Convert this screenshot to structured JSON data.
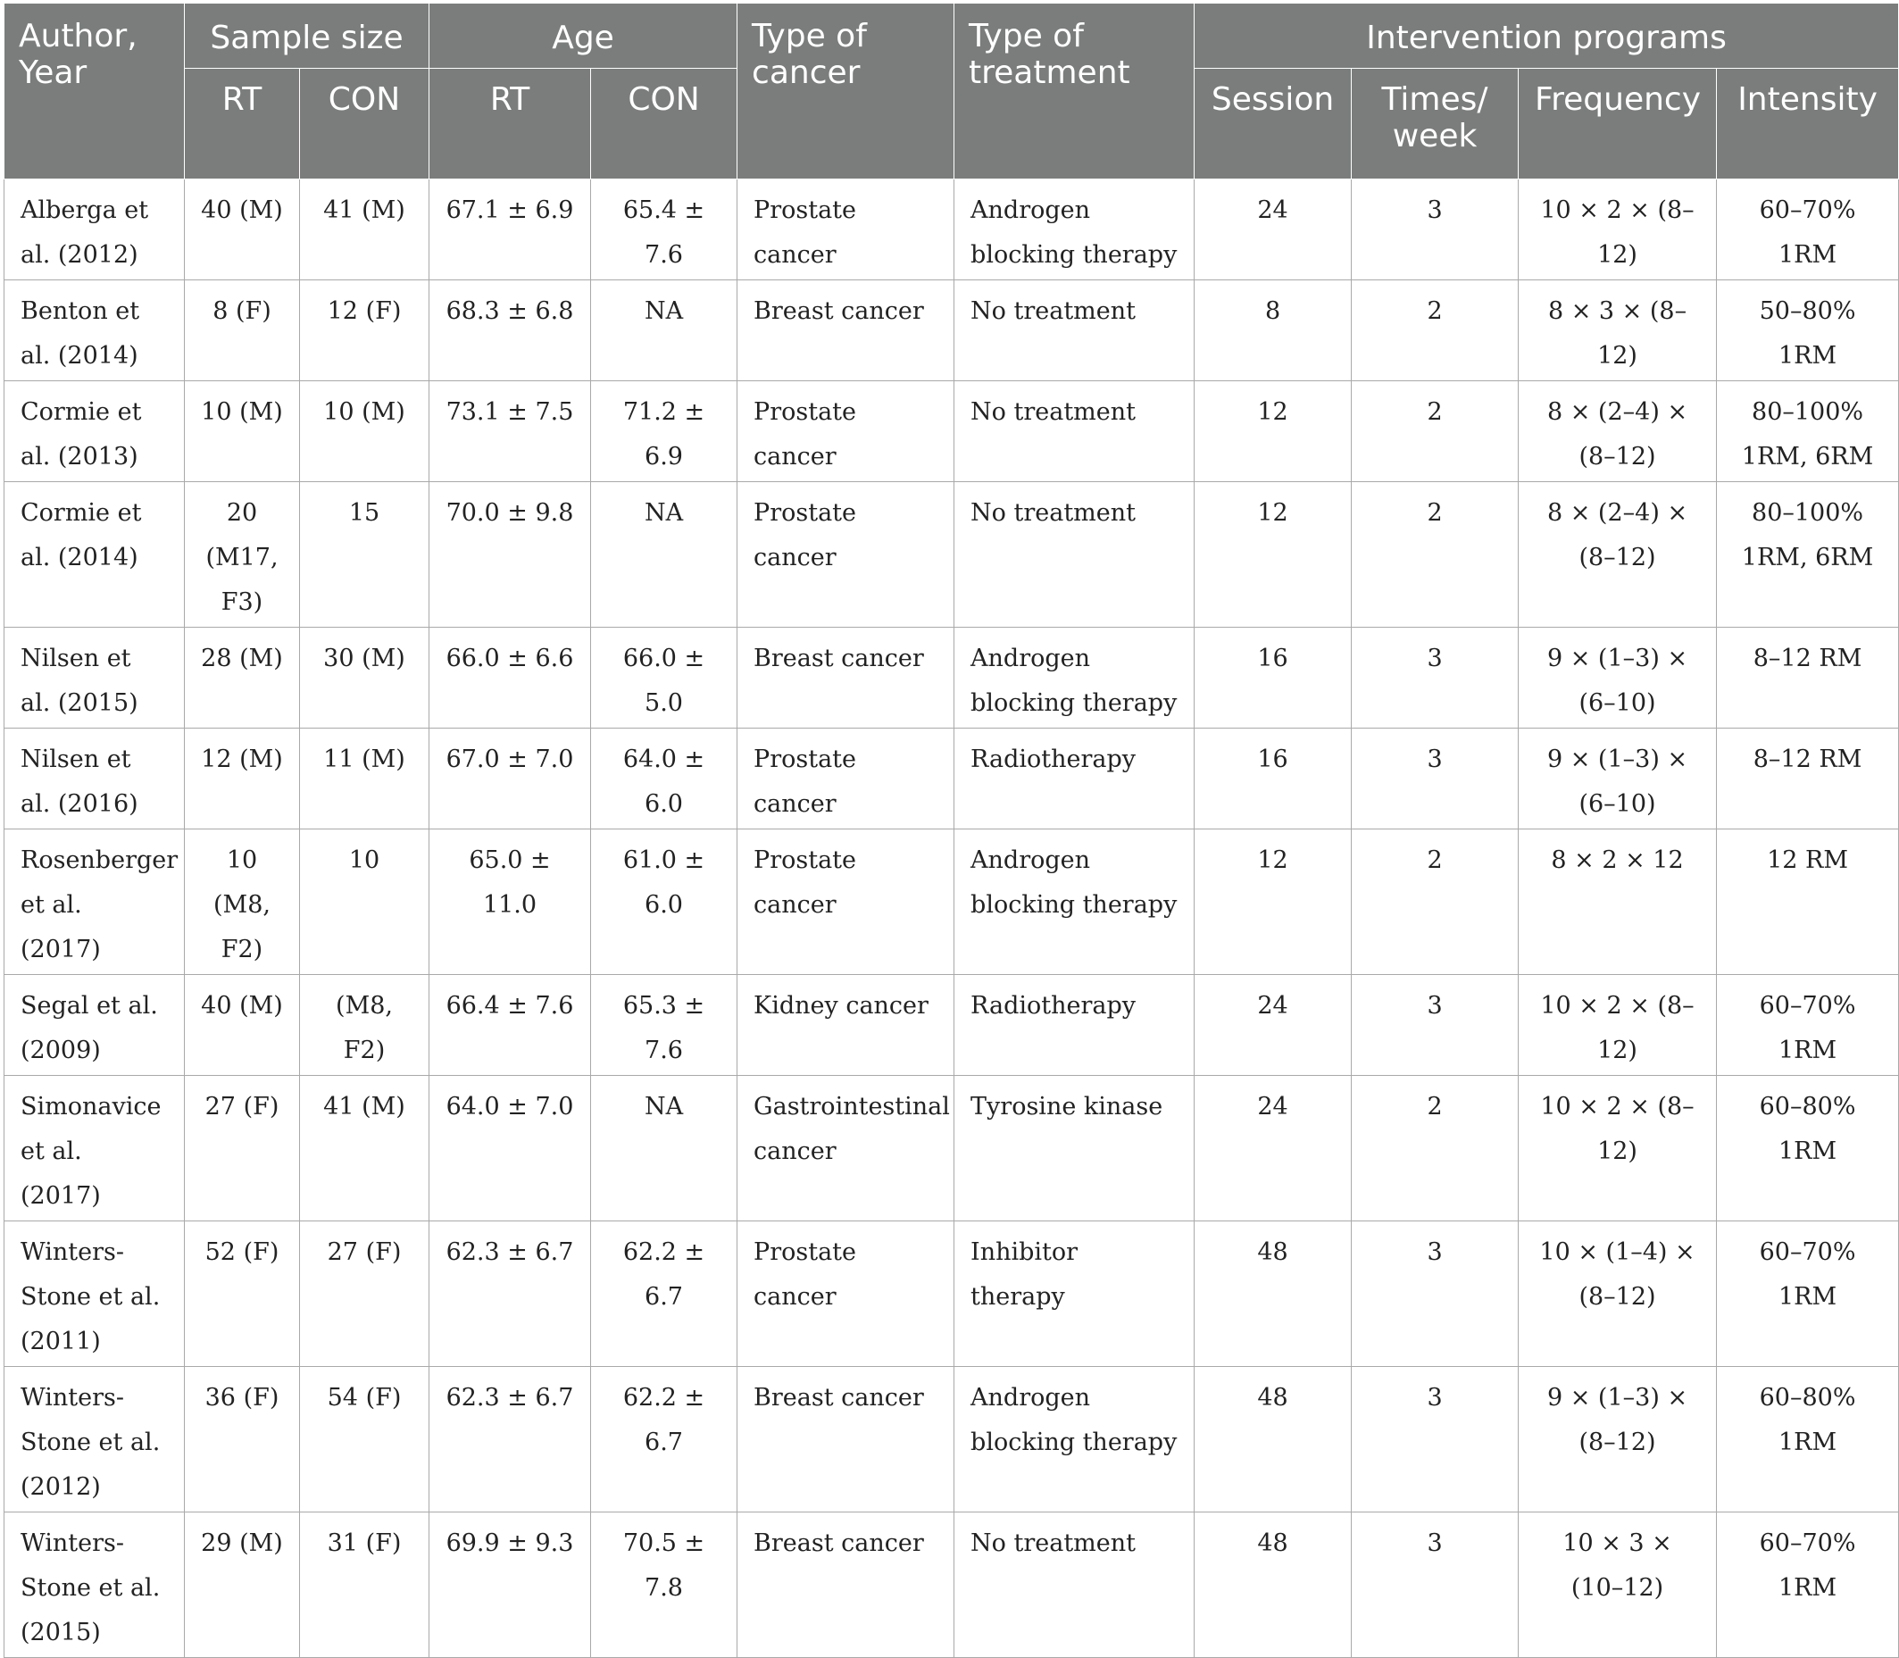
{
  "headers": {
    "author": "Author, Year",
    "sample_size": "Sample size",
    "age": "Age",
    "type_of_cancer": "Type of cancer",
    "type_of_treatment": "Type of treatment",
    "intervention_programs": "Intervention programs",
    "rt": "RT",
    "con": "CON",
    "session": "Session",
    "times_week": "Times/ week",
    "frequency": "Frequency",
    "intensity": "Intensity"
  },
  "rows": [
    {
      "author": "Alberga et al. (2012)",
      "rt_n": "40 (M)",
      "con_n": "41 (M)",
      "rt_age": "67.1 ± 6.9",
      "con_age": "65.4 ± 7.6",
      "cancer": "Prostate cancer",
      "treatment": "Androgen blocking therapy",
      "session": "24",
      "times": "3",
      "frequency": "10 × 2 × (8–12)",
      "intensity": "60–70% 1RM"
    },
    {
      "author": "Benton et al. (2014)",
      "rt_n": "8 (F)",
      "con_n": "12 (F)",
      "rt_age": "68.3 ± 6.8",
      "con_age": "NA",
      "cancer": "Breast cancer",
      "treatment": "No treatment",
      "session": "8",
      "times": "2",
      "frequency": "8 × 3 × (8–12)",
      "intensity": "50–80% 1RM"
    },
    {
      "author": "Cormie et al. (2013)",
      "rt_n": "10 (M)",
      "con_n": "10 (M)",
      "rt_age": "73.1 ± 7.5",
      "con_age": "71.2 ± 6.9",
      "cancer": "Prostate cancer",
      "treatment": "No treatment",
      "session": "12",
      "times": "2",
      "frequency": "8 × (2–4) × (8–12)",
      "intensity": "80–100% 1RM, 6RM"
    },
    {
      "author": "Cormie et al. (2014)",
      "rt_n": "20 (M17, F3)",
      "con_n": "15",
      "rt_age": "70.0 ± 9.8",
      "con_age": "NA",
      "cancer": "Prostate cancer",
      "treatment": "No treatment",
      "session": "12",
      "times": "2",
      "frequency": "8 × (2–4) × (8–12)",
      "intensity": "80–100% 1RM, 6RM"
    },
    {
      "author": "Nilsen et al. (2015)",
      "rt_n": "28 (M)",
      "con_n": "30 (M)",
      "rt_age": "66.0 ± 6.6",
      "con_age": "66.0 ± 5.0",
      "cancer": "Breast cancer",
      "treatment": "Androgen blocking therapy",
      "session": "16",
      "times": "3",
      "frequency": "9 × (1–3) × (6–10)",
      "intensity": "8–12 RM"
    },
    {
      "author": "Nilsen et al. (2016)",
      "rt_n": "12 (M)",
      "con_n": "11 (M)",
      "rt_age": "67.0 ± 7.0",
      "con_age": "64.0 ± 6.0",
      "cancer": "Prostate cancer",
      "treatment": "Radiotherapy",
      "session": "16",
      "times": "3",
      "frequency": "9 × (1–3) × (6–10)",
      "intensity": "8–12 RM"
    },
    {
      "author": "Rosenberger et al. (2017)",
      "rt_n": "10 (M8, F2)",
      "con_n": "10",
      "rt_age": "65.0 ± 11.0",
      "con_age": "61.0 ± 6.0",
      "cancer": "Prostate cancer",
      "treatment": "Androgen blocking therapy",
      "session": "12",
      "times": "2",
      "frequency": "8 × 2 × 12",
      "intensity": "12 RM"
    },
    {
      "author": "Segal et al. (2009)",
      "rt_n": "40 (M)",
      "con_n": "(M8, F2)",
      "rt_age": "66.4 ± 7.6",
      "con_age": "65.3 ± 7.6",
      "cancer": "Kidney cancer",
      "treatment": "Radiotherapy",
      "session": "24",
      "times": "3",
      "frequency": "10 × 2 × (8–12)",
      "intensity": "60–70% 1RM"
    },
    {
      "author": "Simonavice et al. (2017)",
      "rt_n": "27 (F)",
      "con_n": "41 (M)",
      "rt_age": "64.0 ± 7.0",
      "con_age": "NA",
      "cancer": "Gastrointestinal cancer",
      "treatment": "Tyrosine kinase",
      "session": "24",
      "times": "2",
      "frequency": "10 × 2 × (8–12)",
      "intensity": "60–80% 1RM"
    },
    {
      "author": "Winters-Stone et al. (2011)",
      "rt_n": "52 (F)",
      "con_n": "27 (F)",
      "rt_age": "62.3 ± 6.7",
      "con_age": "62.2 ± 6.7",
      "cancer": "Prostate cancer",
      "treatment": "Inhibitor therapy",
      "session": "48",
      "times": "3",
      "frequency": "10 × (1–4) × (8–12)",
      "intensity": "60–70% 1RM"
    },
    {
      "author": "Winters-Stone et al. (2012)",
      "rt_n": "36 (F)",
      "con_n": "54 (F)",
      "rt_age": "62.3 ± 6.7",
      "con_age": "62.2 ± 6.7",
      "cancer": "Breast cancer",
      "treatment": "Androgen blocking therapy",
      "session": "48",
      "times": "3",
      "frequency": "9 × (1–3) × (8–12)",
      "intensity": "60–80% 1RM"
    },
    {
      "author": "Winters-Stone et al. (2015)",
      "rt_n": "29 (M)",
      "con_n": "31 (F)",
      "rt_age": "69.9 ± 9.3",
      "con_age": "70.5 ± 7.8",
      "cancer": "Breast cancer",
      "treatment": "No treatment",
      "session": "48",
      "times": "3",
      "frequency": "10 × 3 × (10–12)",
      "intensity": "60–70% 1RM"
    }
  ]
}
